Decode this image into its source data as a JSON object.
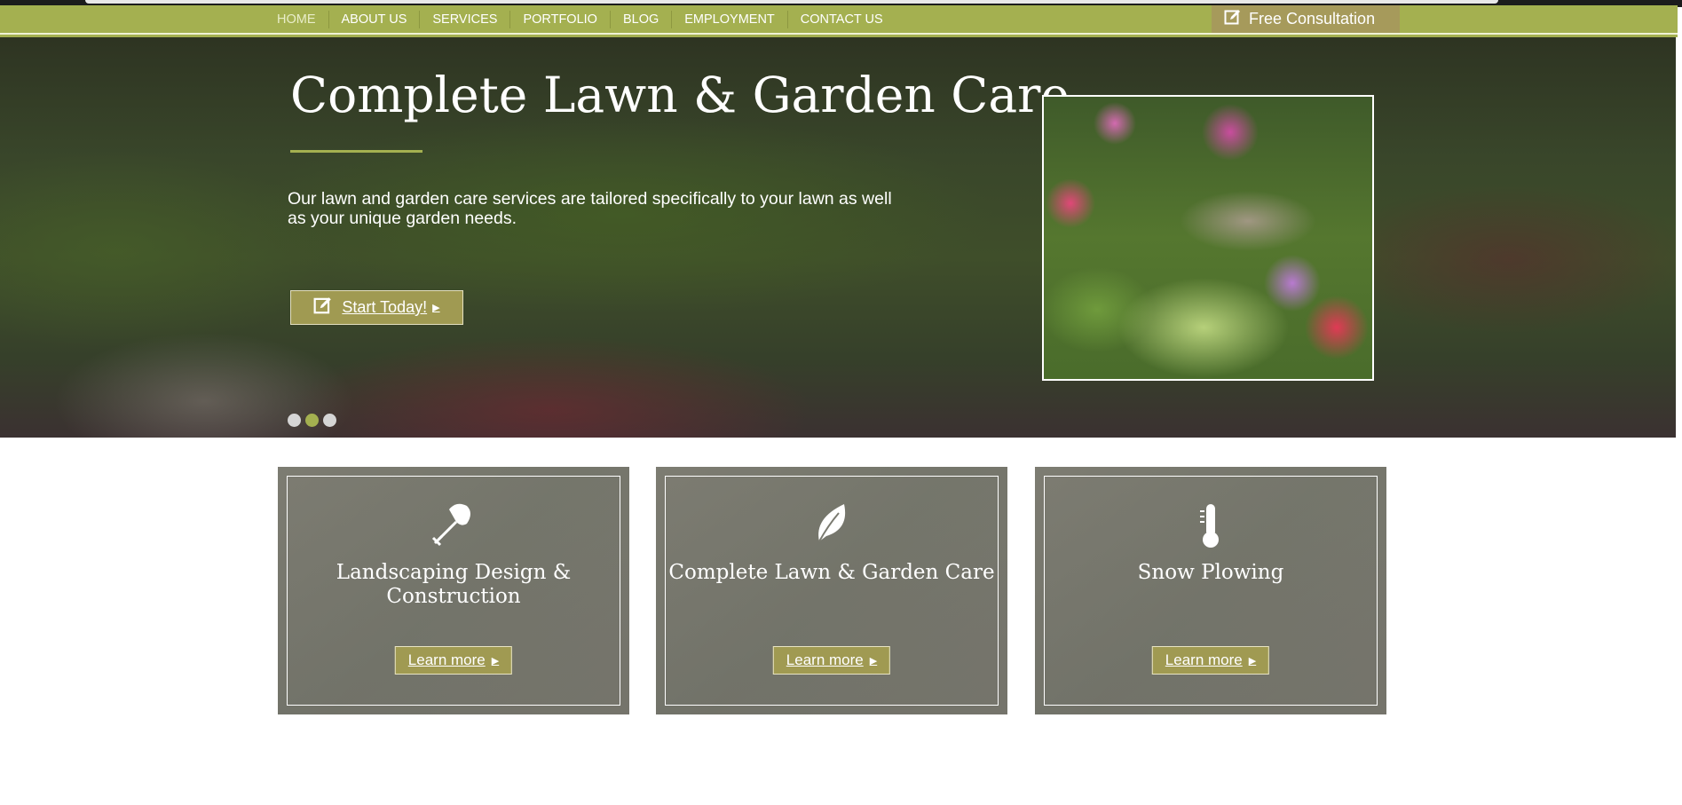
{
  "nav": {
    "items": [
      {
        "label": "HOME",
        "active": true
      },
      {
        "label": "ABOUT US"
      },
      {
        "label": "SERVICES"
      },
      {
        "label": "PORTFOLIO"
      },
      {
        "label": "BLOG"
      },
      {
        "label": "EMPLOYMENT"
      },
      {
        "label": "CONTACT US"
      }
    ],
    "cta_label": "Free Consultation",
    "cta_icon": "edit-icon"
  },
  "hero": {
    "title": "Complete Lawn & Garden Care",
    "text": "Our lawn and garden care services are tailored specifically to your lawn as well as your unique garden needs.",
    "button_label": "Start Today!",
    "button_icon": "edit-icon",
    "slides": {
      "count": 3,
      "active_index": 1
    }
  },
  "services": [
    {
      "title": "Landscaping Design & Construction",
      "icon": "shovel-icon",
      "button_label": "Learn more"
    },
    {
      "title": "Complete Lawn & Garden Care",
      "icon": "leaf-icon",
      "button_label": "Learn more"
    },
    {
      "title": "Snow Plowing",
      "icon": "thermometer-icon",
      "button_label": "Learn more"
    }
  ],
  "colors": {
    "accent": "#a4b050",
    "button": "#a09a52",
    "consult_button": "#a69a5b"
  }
}
